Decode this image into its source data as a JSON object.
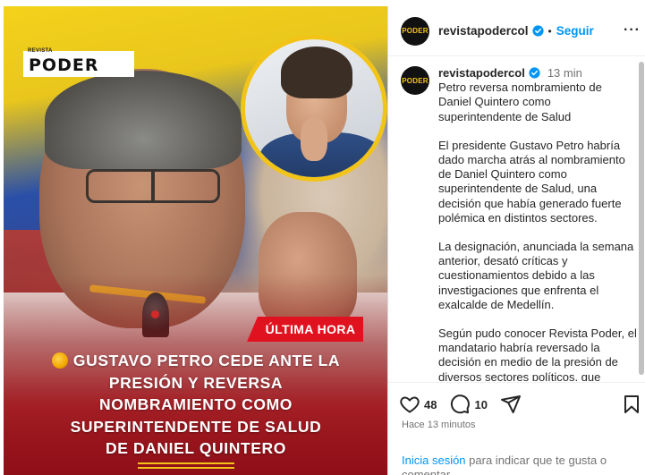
{
  "media": {
    "brand_logo_small": "REVISTA",
    "brand_logo": "PODER",
    "badge": "ÚLTIMA HORA",
    "headline_lines": [
      "GUSTAVO PETRO CEDE ANTE LA",
      "PRESIÓN Y REVERSA",
      "NOMBRAMIENTO COMO",
      "SUPERINTENDENTE DE SALUD",
      "DE DANIEL QUINTERO"
    ],
    "colors": {
      "badge": "#e1121f",
      "accent_yellow": "#f2c418",
      "banner_red": "#8f0f18"
    }
  },
  "header": {
    "avatar_text": "PODER",
    "username": "revistapodercol",
    "separator": "•",
    "follow_label": "Seguir",
    "more_icon": "more-horizontal-icon"
  },
  "caption": {
    "username": "revistapodercol",
    "time": "13 min",
    "title": "Petro reversa nombramiento de Daniel Quintero como superintendente de Salud",
    "paragraphs": [
      "El presidente Gustavo Petro habría dado marcha atrás al nombramiento de Daniel Quintero como superintendente de Salud, una decisión que había generado fuerte polémica en distintos sectores.",
      "La designación, anunciada la semana anterior, desató críticas y cuestionamientos debido a las investigaciones que enfrenta el exalcalde de Medellín.",
      "Según pudo conocer Revista Poder, el mandatario habría reversado la decisión en medio de la presión de diversos sectores políticos, que"
    ]
  },
  "actions": {
    "likes": "48",
    "comments": "10",
    "icons": [
      "heart-icon",
      "comment-icon",
      "share-icon",
      "bookmark-icon"
    ],
    "timestamp": "Hace 13 minutos",
    "login_link": "Inicia sesión",
    "login_text": "para indicar que te gusta o comentar."
  },
  "colors": {
    "link": "#0095f6",
    "text": "#262626",
    "muted": "#737373"
  }
}
